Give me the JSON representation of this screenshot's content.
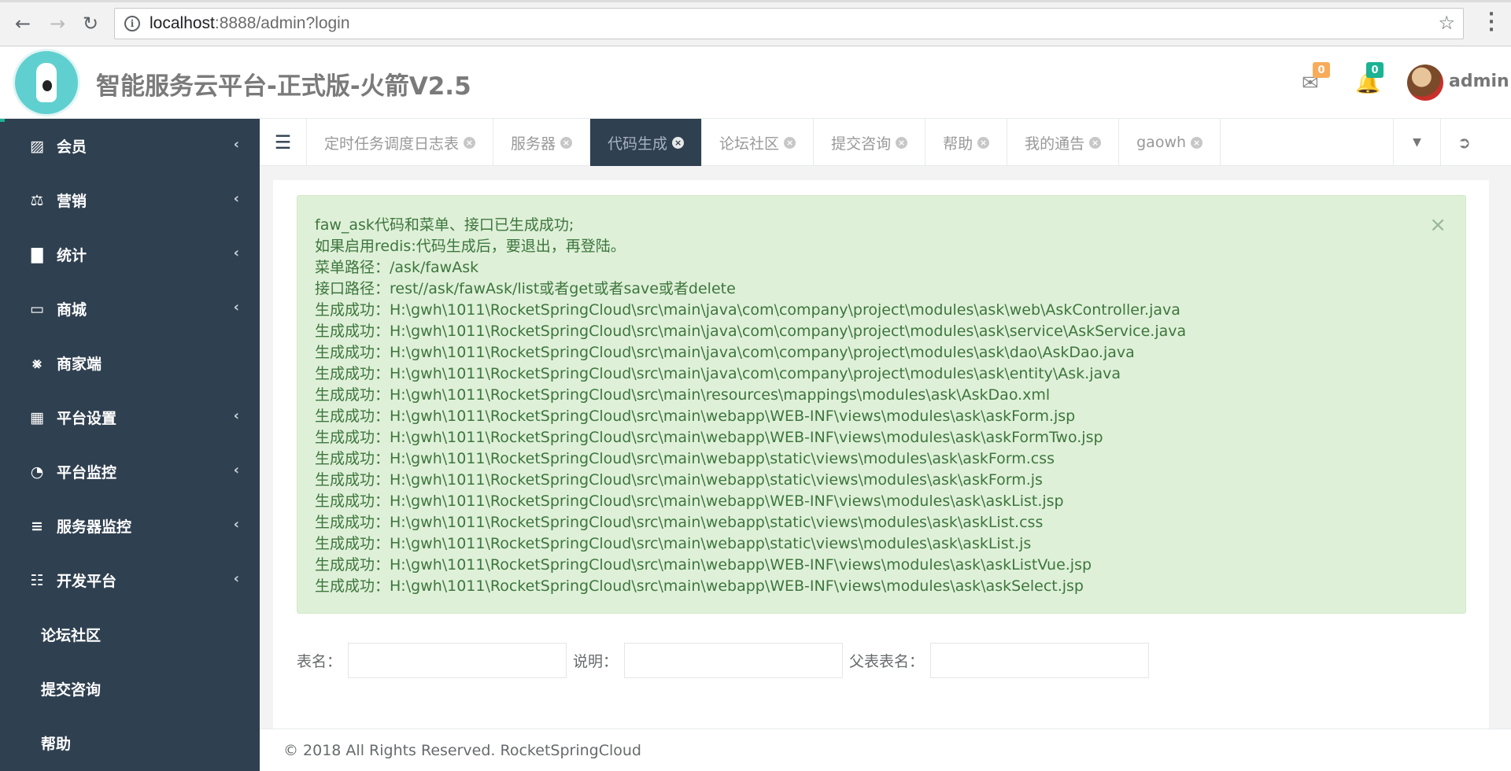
{
  "browser": {
    "url_host": "localhost",
    "url_rest": ":8888/admin?login"
  },
  "header": {
    "title": "智能服务云平台-正式版-火箭V2.5",
    "mail_count": "0",
    "bell_count": "0",
    "user": "admin",
    "colors": {
      "mail_badge": "#f8ac59",
      "bell_badge": "#1ab394"
    }
  },
  "sidebar": {
    "items": [
      {
        "label": "会员",
        "icon": "map-icon",
        "has_arrow": true
      },
      {
        "label": "营销",
        "icon": "balance-scale-icon",
        "has_arrow": true
      },
      {
        "label": "统计",
        "icon": "bar-chart-icon",
        "has_arrow": true
      },
      {
        "label": "商城",
        "icon": "desktop-icon",
        "has_arrow": true
      },
      {
        "label": "商家端",
        "icon": "cart-icon",
        "has_arrow": false
      },
      {
        "label": "平台设置",
        "icon": "grid-icon",
        "has_arrow": true
      },
      {
        "label": "平台监控",
        "icon": "dashboard-icon",
        "has_arrow": true
      },
      {
        "label": "服务器监控",
        "icon": "database-icon",
        "has_arrow": true
      },
      {
        "label": "开发平台",
        "icon": "th-icon",
        "has_arrow": true
      }
    ],
    "subitems": [
      "论坛社区",
      "提交咨询",
      "帮助"
    ]
  },
  "tabs": [
    {
      "label": "定时任务调度日志表",
      "active": false
    },
    {
      "label": "服务器",
      "active": false
    },
    {
      "label": "代码生成",
      "active": true
    },
    {
      "label": "论坛社区",
      "active": false
    },
    {
      "label": "提交咨询",
      "active": false
    },
    {
      "label": "帮助",
      "active": false
    },
    {
      "label": "我的通告",
      "active": false
    },
    {
      "label": "gaowh",
      "active": false
    }
  ],
  "alert": {
    "lines": [
      "faw_ask代码和菜单、接口已生成成功;",
      "如果启用redis:代码生成后，要退出，再登陆。",
      "菜单路径：/ask/fawAsk",
      "接口路径：rest//ask/fawAsk/list或者get或者save或者delete",
      "生成成功：H:\\gwh\\1011\\RocketSpringCloud\\src\\main\\java\\com\\company\\project\\modules\\ask\\web\\AskController.java",
      "生成成功：H:\\gwh\\1011\\RocketSpringCloud\\src\\main\\java\\com\\company\\project\\modules\\ask\\service\\AskService.java",
      "生成成功：H:\\gwh\\1011\\RocketSpringCloud\\src\\main\\java\\com\\company\\project\\modules\\ask\\dao\\AskDao.java",
      "生成成功：H:\\gwh\\1011\\RocketSpringCloud\\src\\main\\java\\com\\company\\project\\modules\\ask\\entity\\Ask.java",
      "生成成功：H:\\gwh\\1011\\RocketSpringCloud\\src\\main\\resources\\mappings\\modules\\ask\\AskDao.xml",
      "生成成功：H:\\gwh\\1011\\RocketSpringCloud\\src\\main\\webapp\\WEB-INF\\views\\modules\\ask\\askForm.jsp",
      "生成成功：H:\\gwh\\1011\\RocketSpringCloud\\src\\main\\webapp\\WEB-INF\\views\\modules\\ask\\askFormTwo.jsp",
      "生成成功：H:\\gwh\\1011\\RocketSpringCloud\\src\\main\\webapp\\static\\views\\modules\\ask\\askForm.css",
      "生成成功：H:\\gwh\\1011\\RocketSpringCloud\\src\\main\\webapp\\static\\views\\modules\\ask\\askForm.js",
      "生成成功：H:\\gwh\\1011\\RocketSpringCloud\\src\\main\\webapp\\WEB-INF\\views\\modules\\ask\\askList.jsp",
      "生成成功：H:\\gwh\\1011\\RocketSpringCloud\\src\\main\\webapp\\static\\views\\modules\\ask\\askList.css",
      "生成成功：H:\\gwh\\1011\\RocketSpringCloud\\src\\main\\webapp\\static\\views\\modules\\ask\\askList.js",
      "生成成功：H:\\gwh\\1011\\RocketSpringCloud\\src\\main\\webapp\\WEB-INF\\views\\modules\\ask\\askListVue.jsp",
      "生成成功：H:\\gwh\\1011\\RocketSpringCloud\\src\\main\\webapp\\WEB-INF\\views\\modules\\ask\\askSelect.jsp"
    ]
  },
  "search_form": {
    "table_name_label": "表名：",
    "comments_label": "说明：",
    "parent_table_label": "父表表名："
  },
  "footer": {
    "text": "© 2018 All Rights Reserved. RocketSpringCloud"
  }
}
